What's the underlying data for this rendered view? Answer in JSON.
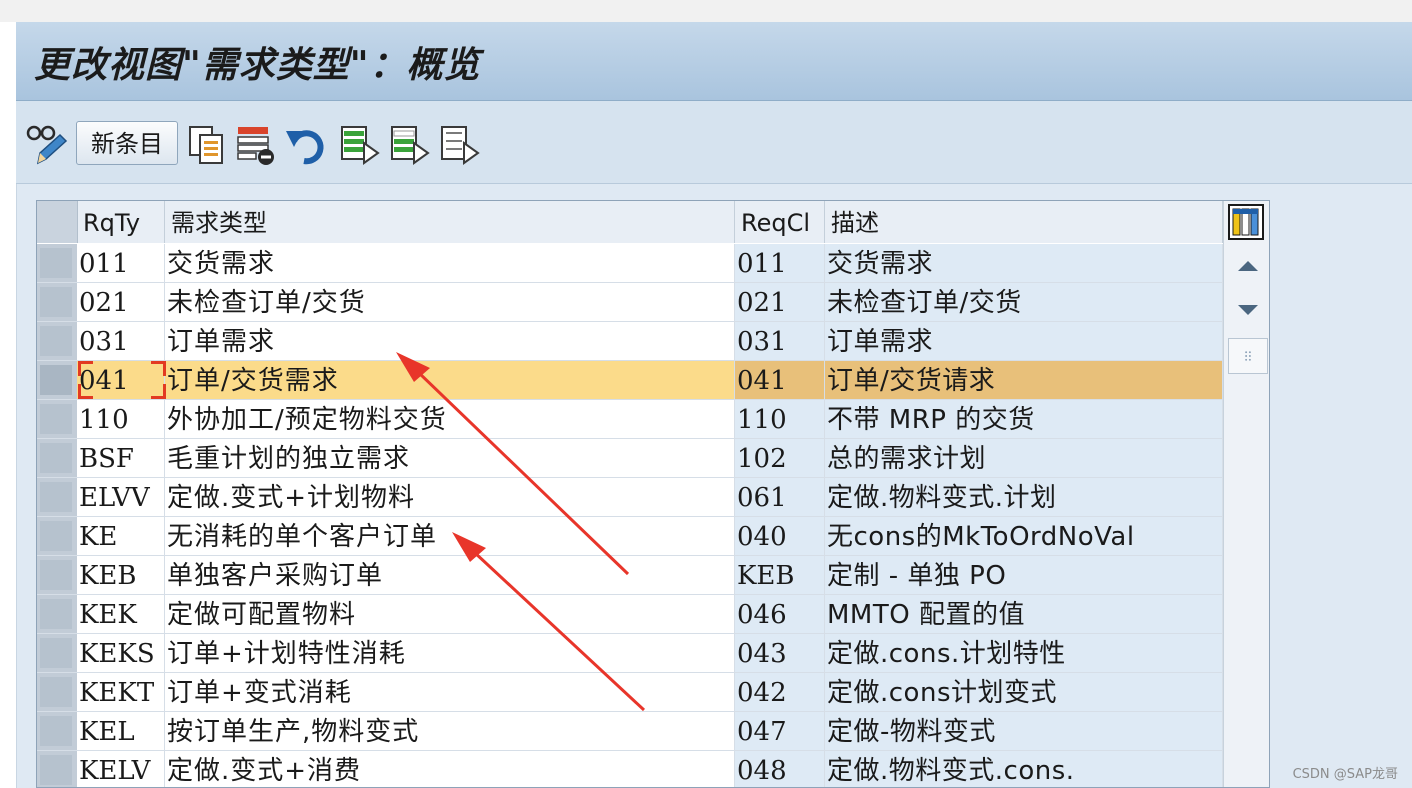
{
  "window": {
    "title": "更改视图\"需求类型\"：概览"
  },
  "toolbar": {
    "new_entry_label": "新条目",
    "icons": [
      "display-change-icon",
      "copy-icon",
      "delete-icon",
      "undo-icon",
      "select-all-icon",
      "select-block-icon",
      "deselect-all-icon"
    ]
  },
  "table": {
    "headers": [
      "RqTy",
      "需求类型",
      "ReqCl",
      "描述"
    ],
    "rows": [
      {
        "key": "011",
        "name": "交货需求",
        "cls": "011",
        "desc": "交货需求"
      },
      {
        "key": "021",
        "name": "未检查订单/交货",
        "cls": "021",
        "desc": "未检查订单/交货"
      },
      {
        "key": "031",
        "name": "订单需求",
        "cls": "031",
        "desc": "订单需求"
      },
      {
        "key": "041",
        "name": "订单/交货需求",
        "cls": "041",
        "desc": "订单/交货请求"
      },
      {
        "key": "110",
        "name": "外协加工/预定物料交货",
        "cls": "110",
        "desc": "不带 MRP 的交货"
      },
      {
        "key": "BSF",
        "name": "毛重计划的独立需求",
        "cls": "102",
        "desc": "总的需求计划"
      },
      {
        "key": "ELVV",
        "name": "定做.变式+计划物料",
        "cls": "061",
        "desc": "定做.物料变式.计划"
      },
      {
        "key": "KE",
        "name": "无消耗的单个客户订单",
        "cls": "040",
        "desc": "无cons的MkToOrdNoVal"
      },
      {
        "key": "KEB",
        "name": "单独客户采购订单",
        "cls": "KEB",
        "desc": "定制 - 单独 PO"
      },
      {
        "key": "KEK",
        "name": "定做可配置物料",
        "cls": "046",
        "desc": "MMTO 配置的值"
      },
      {
        "key": "KEKS",
        "name": "订单+计划特性消耗",
        "cls": "043",
        "desc": "定做.cons.计划特性"
      },
      {
        "key": "KEKT",
        "name": "订单+变式消耗",
        "cls": "042",
        "desc": "定做.cons计划变式"
      },
      {
        "key": "KEL",
        "name": "按订单生产,物料变式",
        "cls": "047",
        "desc": "定做-物料变式"
      },
      {
        "key": "KELV",
        "name": "定做.变式+消费",
        "cls": "048",
        "desc": "定做.物料变式.cons."
      }
    ],
    "selected_row": "041"
  },
  "colors": {
    "selected_row": "#fbdb8a",
    "selected_row_alt": "#e8c07a",
    "readonly_column": "#deeaf5",
    "annotation_arrow": "#e8352a"
  },
  "watermark": "CSDN @SAP龙哥"
}
